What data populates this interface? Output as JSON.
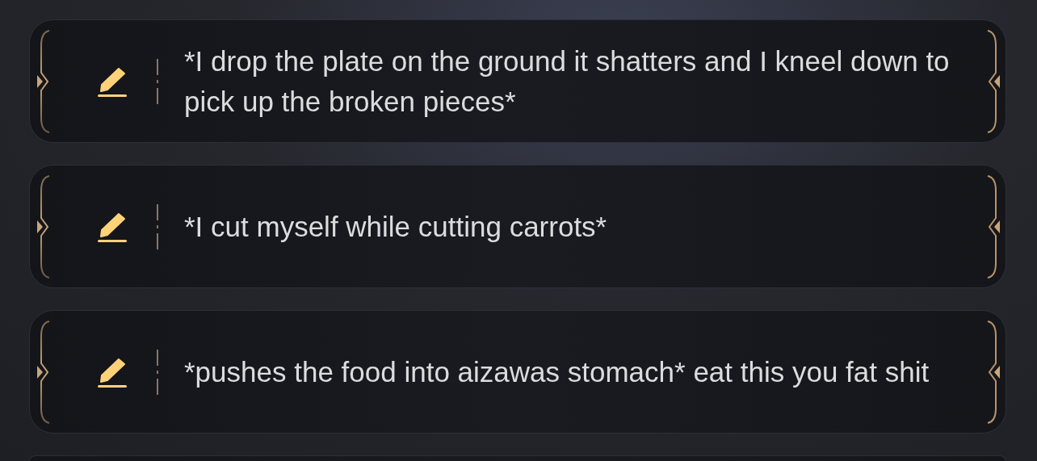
{
  "suggestions": [
    {
      "text": "*I drop the plate on the ground it shatters and I kneel down to pick up the broken pieces*"
    },
    {
      "text": "*I cut myself while cutting carrots*"
    },
    {
      "text": "*pushes the food into aizawas stomach* eat this you fat shit"
    }
  ]
}
